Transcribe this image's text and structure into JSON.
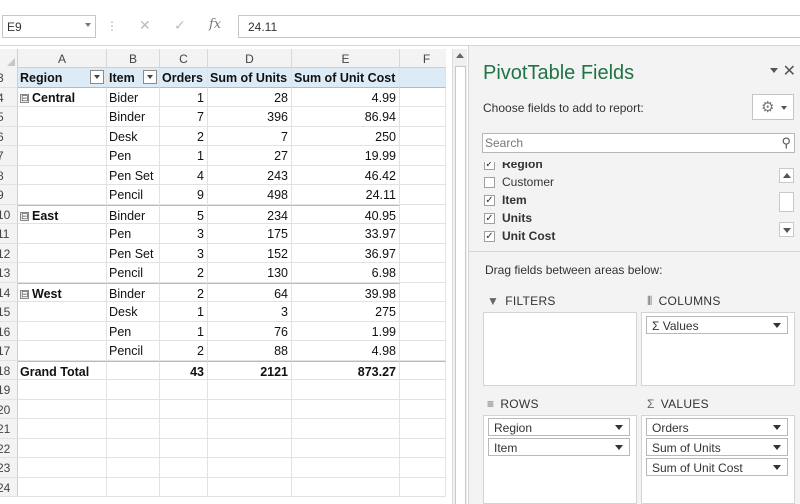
{
  "formula_bar": {
    "name_box": "E9",
    "cancel_icon": "✕",
    "enter_icon": "✓",
    "fx_label": "fx",
    "value": "24.11"
  },
  "grid": {
    "columns": [
      "A",
      "B",
      "C",
      "D",
      "E",
      "F"
    ],
    "headers": {
      "region": "Region",
      "item": "Item",
      "orders": "Orders",
      "sum_units": "Sum of Units",
      "sum_unit_cost": "Sum of Unit Cost"
    },
    "rows": [
      {
        "n": "3"
      },
      {
        "n": "4",
        "region": "Central",
        "item": "Bider",
        "orders": "1",
        "units": "28",
        "cost": "4.99"
      },
      {
        "n": "5",
        "item": "Binder",
        "orders": "7",
        "units": "396",
        "cost": "86.94"
      },
      {
        "n": "6",
        "item": "Desk",
        "orders": "2",
        "units": "7",
        "cost": "250"
      },
      {
        "n": "7",
        "item": "Pen",
        "orders": "1",
        "units": "27",
        "cost": "19.99"
      },
      {
        "n": "8",
        "item": "Pen Set",
        "orders": "4",
        "units": "243",
        "cost": "46.42"
      },
      {
        "n": "9",
        "item": "Pencil",
        "orders": "9",
        "units": "498",
        "cost": "24.11"
      },
      {
        "n": "10",
        "region": "East",
        "item": "Binder",
        "orders": "5",
        "units": "234",
        "cost": "40.95"
      },
      {
        "n": "11",
        "item": "Pen",
        "orders": "3",
        "units": "175",
        "cost": "33.97"
      },
      {
        "n": "12",
        "item": "Pen Set",
        "orders": "3",
        "units": "152",
        "cost": "36.97"
      },
      {
        "n": "13",
        "item": "Pencil",
        "orders": "2",
        "units": "130",
        "cost": "6.98"
      },
      {
        "n": "14",
        "region": "West",
        "item": "Binder",
        "orders": "2",
        "units": "64",
        "cost": "39.98"
      },
      {
        "n": "15",
        "item": "Desk",
        "orders": "1",
        "units": "3",
        "cost": "275"
      },
      {
        "n": "16",
        "item": "Pen",
        "orders": "1",
        "units": "76",
        "cost": "1.99"
      },
      {
        "n": "17",
        "item": "Pencil",
        "orders": "2",
        "units": "88",
        "cost": "4.98"
      },
      {
        "n": "18",
        "region": "Grand Total",
        "orders": "43",
        "units": "2121",
        "cost": "873.27"
      },
      {
        "n": "19"
      },
      {
        "n": "20"
      },
      {
        "n": "21"
      },
      {
        "n": "22"
      },
      {
        "n": "23"
      },
      {
        "n": "24"
      }
    ],
    "expander_symbol": "⊟"
  },
  "pivot_pane": {
    "title": "PivotTable Fields",
    "close_icon": "✕",
    "choose_label": "Choose fields to add to report:",
    "gear_icon": "⚙",
    "search_placeholder": "Search",
    "search_icon": "⚲",
    "fields": [
      {
        "label": "Region",
        "checked": true
      },
      {
        "label": "Customer",
        "checked": false
      },
      {
        "label": "Item",
        "checked": true
      },
      {
        "label": "Units",
        "checked": true
      },
      {
        "label": "Unit Cost",
        "checked": true
      }
    ],
    "check_mark": "✓",
    "drag_label": "Drag fields between areas below:",
    "areas": {
      "filters": {
        "label": "FILTERS",
        "icon": "▼"
      },
      "columns": {
        "label": "COLUMNS",
        "icon": "⦀",
        "items": [
          "Values"
        ]
      },
      "rows": {
        "label": "ROWS",
        "icon": "≡",
        "items": [
          "Region",
          "Item"
        ]
      },
      "values": {
        "label": "VALUES",
        "icon": "Σ",
        "items": [
          "Orders",
          "Sum of Units",
          "Sum of Unit Cost"
        ]
      }
    },
    "values_pill_prefix": "Σ"
  },
  "colors": {
    "title_green": "#217346",
    "header_fill": "#ddebf7",
    "header_border": "#9bc2e6"
  }
}
